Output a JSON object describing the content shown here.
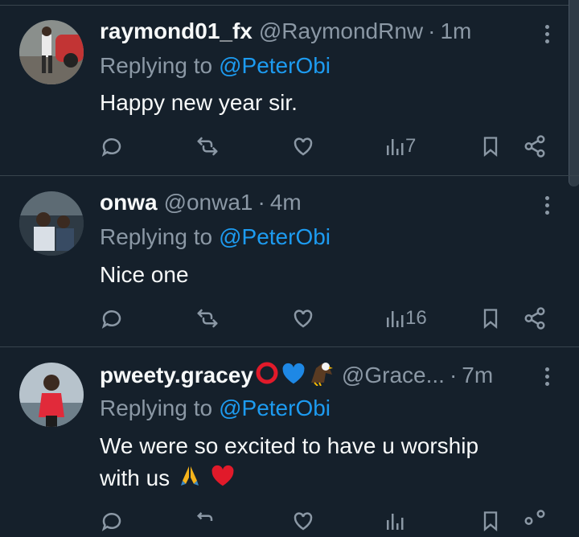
{
  "colors": {
    "background": "#15202b",
    "text": "#f7f9f9",
    "muted": "#8b98a5",
    "link": "#1d9bf0",
    "divider": "#38444d"
  },
  "tweets": [
    {
      "display_name": "raymond01_fx",
      "handle": "@RaymondRnw",
      "separator": "·",
      "time": "1m",
      "replying_prefix": "Replying to",
      "replying_to": "@PeterObi",
      "text": "Happy new year sir.",
      "text_line2": "",
      "views": "7",
      "emoji": []
    },
    {
      "display_name": "onwa",
      "handle": "@onwa1",
      "separator": "·",
      "time": "4m",
      "replying_prefix": "Replying to",
      "replying_to": "@PeterObi",
      "text": "Nice one",
      "text_line2": "",
      "views": "16",
      "emoji": []
    },
    {
      "display_name": "pweety.gracey",
      "handle": "@Grace...",
      "separator": "·",
      "time": "7m",
      "replying_prefix": "Replying to",
      "replying_to": "@PeterObi",
      "text": "We were so excited to have u worship",
      "text_line2": "with us",
      "views": "",
      "emoji": [
        "red-ring",
        "blue-heart",
        "eagle"
      ],
      "text_emoji": [
        "folded-hands",
        "red-heart"
      ]
    }
  ]
}
